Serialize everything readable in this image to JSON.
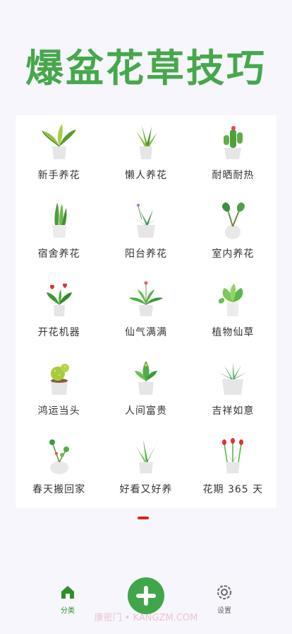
{
  "title": "爆盆花草技巧",
  "categories": [
    {
      "label": "新手养花",
      "icon": "variegated-plant-icon"
    },
    {
      "label": "懒人养花",
      "icon": "aloe-plant-icon"
    },
    {
      "label": "耐晒耐热",
      "icon": "cactus-plant-icon"
    },
    {
      "label": "宿舍养花",
      "icon": "snake-plant-icon"
    },
    {
      "label": "阳台养花",
      "icon": "agave-plant-icon"
    },
    {
      "label": "室内养花",
      "icon": "alocasia-plant-icon"
    },
    {
      "label": "开花机器",
      "icon": "anthurium-plant-icon"
    },
    {
      "label": "仙气满满",
      "icon": "palm-plant-icon"
    },
    {
      "label": "植物仙草",
      "icon": "monstera-plant-icon"
    },
    {
      "label": "鸿运当头",
      "icon": "ball-cactus-icon"
    },
    {
      "label": "人间富贵",
      "icon": "fern-plant-icon"
    },
    {
      "label": "吉祥如意",
      "icon": "succulent-plant-icon"
    },
    {
      "label": "春天搬回家",
      "icon": "pilea-plant-icon"
    },
    {
      "label": "好看又好养",
      "icon": "grass-plant-icon"
    },
    {
      "label": "花期 365 天",
      "icon": "tulip-plant-icon"
    }
  ],
  "tabbar": {
    "home_label": "分类",
    "settings_label": "设置"
  },
  "watermark": "康密门 • KANGZM.COM",
  "colors": {
    "accent": "#46a84b",
    "indicator": "#e02020"
  }
}
